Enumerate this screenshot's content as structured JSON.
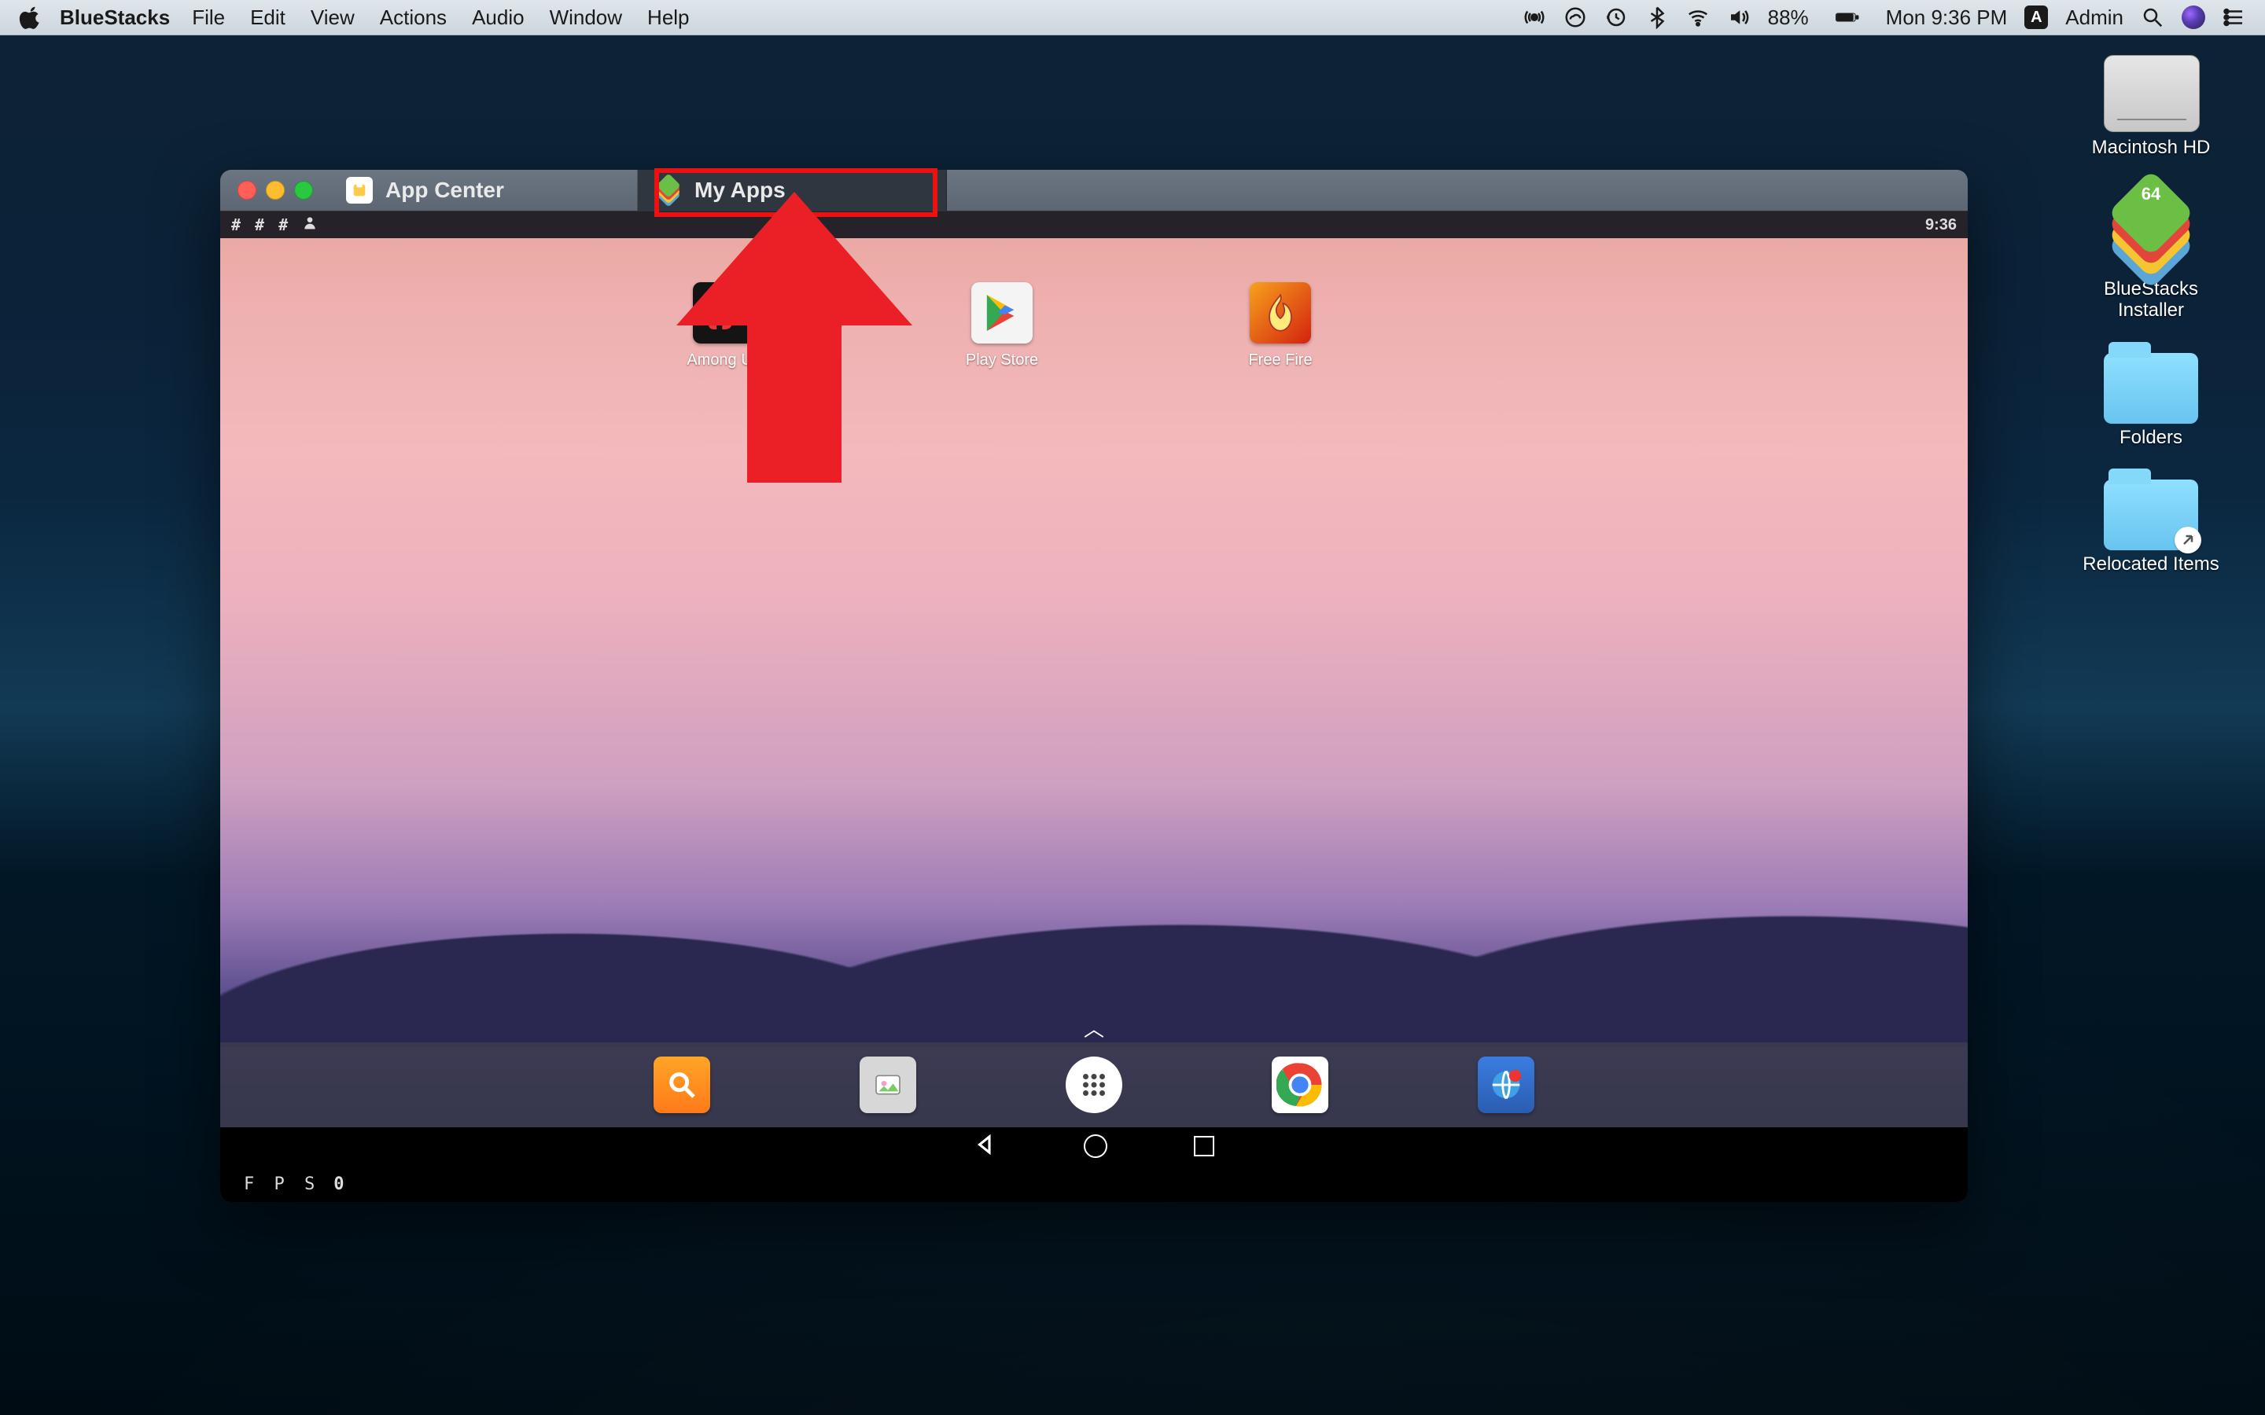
{
  "menubar": {
    "app_name": "BlueStacks",
    "items": [
      "File",
      "Edit",
      "View",
      "Actions",
      "Audio",
      "Window",
      "Help"
    ],
    "battery_pct": "88%",
    "clock": "Mon 9:36 PM",
    "user": "Admin",
    "admin_badge": "A"
  },
  "desktop_icons": [
    {
      "label": "Macintosh HD",
      "name": "macintosh-hd-disk"
    },
    {
      "label": "BlueStacks\nInstaller",
      "name": "bluestacks-installer"
    },
    {
      "label": "Folders",
      "name": "folders"
    },
    {
      "label": "Relocated Items",
      "name": "relocated-items"
    }
  ],
  "window": {
    "tabs": [
      {
        "label": "App Center",
        "name": "tab-app-center"
      },
      {
        "label": "My Apps",
        "name": "tab-my-apps"
      }
    ],
    "android_clock": "9:36",
    "home_apps": [
      {
        "label": "Among Us",
        "name": "app-among-us"
      },
      {
        "label": "Play Store",
        "name": "app-play-store"
      },
      {
        "label": "Free Fire",
        "name": "app-free-fire"
      }
    ],
    "fps_label": "F P S",
    "fps_value": "0"
  },
  "bs_installer_badge": "64"
}
